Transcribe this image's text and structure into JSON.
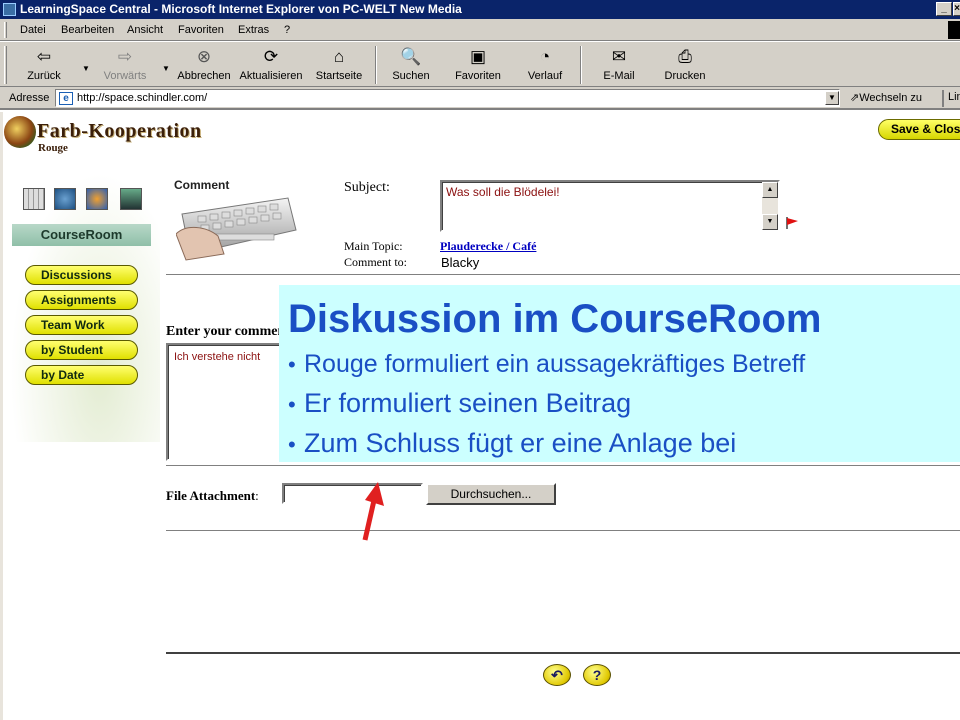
{
  "window": {
    "title": "LearningSpace Central - Microsoft Internet Explorer von PC-WELT New Media",
    "min": "_",
    "close": "×"
  },
  "menu": [
    "Datei",
    "Bearbeiten",
    "Ansicht",
    "Favoriten",
    "Extras",
    "?"
  ],
  "toolbar": {
    "back": "Zurück",
    "forward": "Vorwärts",
    "stop": "Abbrechen",
    "refresh": "Aktualisieren",
    "home": "Startseite",
    "search": "Suchen",
    "favorites": "Favoriten",
    "history": "Verlauf",
    "mail": "E-Mail",
    "print": "Drucken"
  },
  "address": {
    "label": "Adresse",
    "url": "http://space.schindler.com/",
    "go": "Wechseln zu",
    "links": "Links"
  },
  "page": {
    "brand": "Farb-Kooperation",
    "brand_sub": "Rouge",
    "save_close": "Save & Close",
    "courseroom": "CourseRoom",
    "nav": [
      "Discussions",
      "Assignments",
      "Team Work",
      "by Student",
      "by Date"
    ],
    "comment_label": "Comment",
    "subject_label": "Subject:",
    "subject_value": "Was soll die Blödelei!",
    "main_topic_label": "Main Topic:",
    "main_topic_value": "Plauderecke / Café",
    "comment_to_label": "Comment to:",
    "comment_to_value": "Blacky",
    "enter_label": "Enter your comment",
    "body_value": "Ich verstehe nicht",
    "file_label": "File Attachment",
    "file_colon": ":",
    "browse": "Durchsuchen...",
    "help_q": "?"
  },
  "overlay": {
    "title": "Diskussion im CourseRoom",
    "bullets": [
      "Rouge formuliert ein aussagekräftiges Betreff",
      "Er formuliert seinen Beitrag",
      "Zum Schluss fügt er eine Anlage bei"
    ]
  },
  "colors": {
    "overlay_bg": "#ccffff",
    "overlay_text": "#1a4fc4",
    "titlebar": "#0a246a",
    "nav_button": "#e0e000",
    "arrow": "#e02020"
  }
}
